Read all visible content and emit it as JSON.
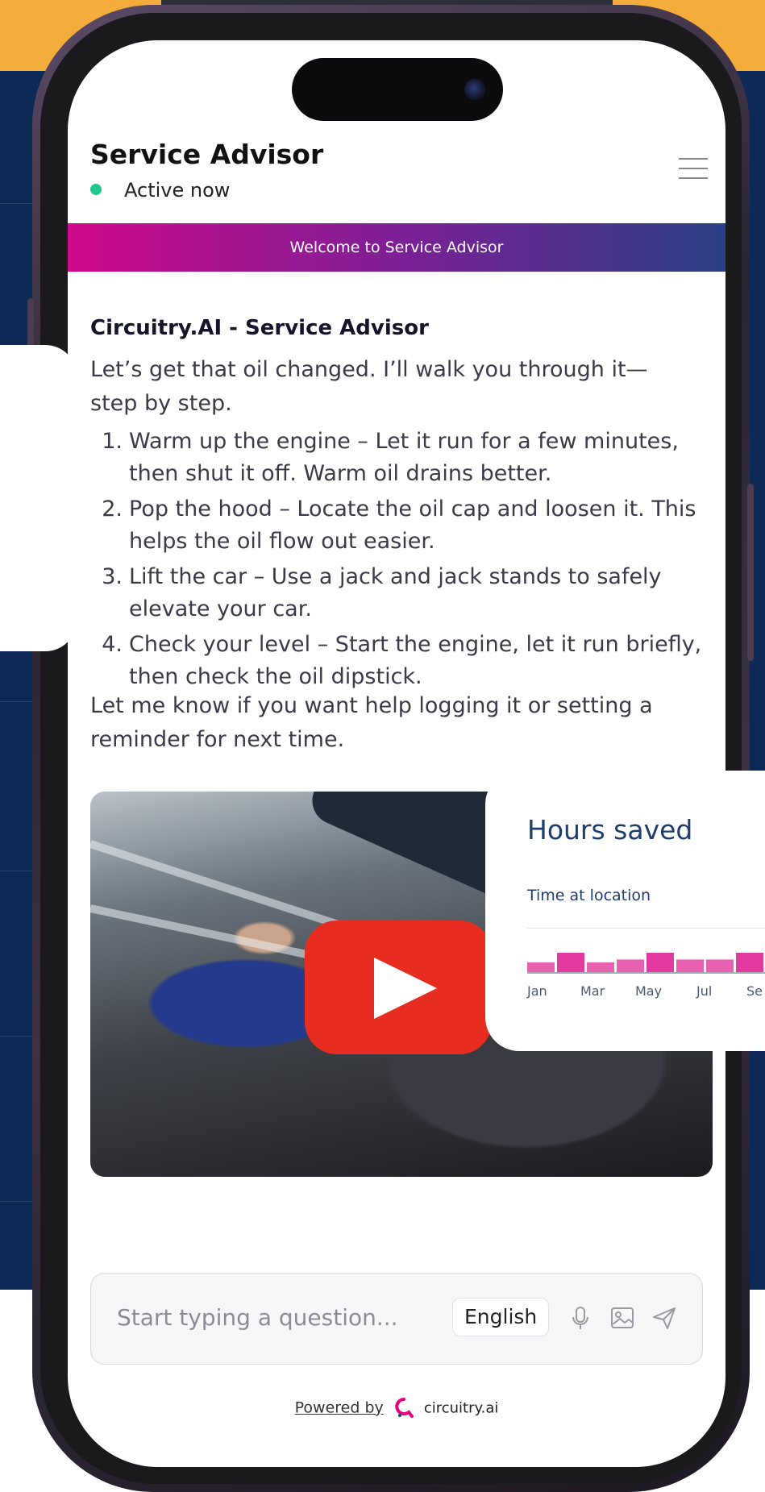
{
  "header": {
    "title": "Service Advisor",
    "status": "Active now",
    "status_color": "#22c58b"
  },
  "banner": {
    "text": "Welcome to Service Advisor"
  },
  "message": {
    "title": "Circuitry.AI - Service Advisor",
    "intro": "Let’s get that oil changed. I’ll walk you through it—step by step.",
    "steps": [
      {
        "num": "1.",
        "text": "Warm up the engine – Let it run for a few minutes, then shut it off. Warm oil drains better."
      },
      {
        "num": "2.",
        "text": "Pop the hood – Locate the oil cap and loosen it. This helps the oil flow out easier."
      },
      {
        "num": "3.",
        "text": "Lift the car – Use a jack and jack stands to safely elevate your car."
      },
      {
        "num": "4.",
        "text": "Check your level – Start the engine, let it run briefly, then check the oil dipstick."
      }
    ],
    "outro": "Let me know if you want help logging it or setting a reminder for next time."
  },
  "composer": {
    "placeholder": "Start typing a question...",
    "language": "English",
    "icons": [
      "microphone-icon",
      "image-icon",
      "send-icon"
    ]
  },
  "footer": {
    "powered_by": "Powered by",
    "brand": "circuitry.ai",
    "brand_color": "#e6007e"
  },
  "hours_card": {
    "title": "Hours saved",
    "subtitle": "Time at location",
    "ticks": [
      "Jan",
      "Mar",
      "May",
      "Jul",
      "Se"
    ],
    "values": [
      1,
      2,
      1,
      1.3,
      2,
      1.3,
      1.3,
      2
    ],
    "bar_color": "#e23a9e"
  }
}
